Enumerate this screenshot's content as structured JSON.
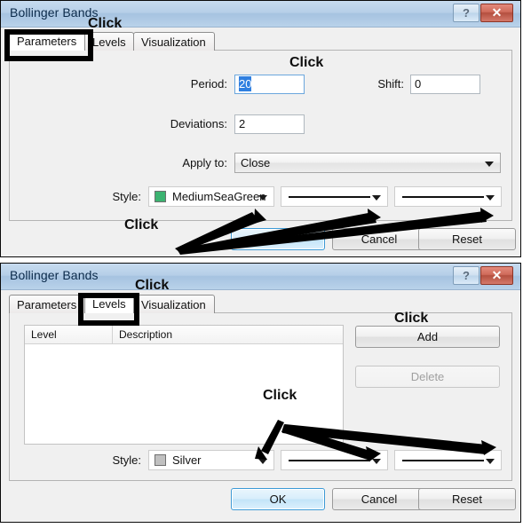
{
  "window_title": "Bollinger Bands",
  "titlebar": {
    "help_label": "?",
    "close_label": "✕"
  },
  "tabs": {
    "parameters": "Parameters",
    "levels": "Levels",
    "visualization": "Visualization"
  },
  "parameters_dialog": {
    "title": "Bollinger Bands",
    "active_tab": "Parameters",
    "fields": {
      "period_label": "Period:",
      "period_value": "20",
      "shift_label": "Shift:",
      "shift_value": "0",
      "deviations_label": "Deviations:",
      "deviations_value": "2",
      "apply_to_label": "Apply to:",
      "apply_to_value": "Close",
      "style_label": "Style:",
      "style_color_name": "MediumSeaGreen",
      "style_color_hex": "#3cb371",
      "line_width_value": "",
      "line_style_value": ""
    },
    "buttons": {
      "ok": "OK",
      "cancel": "Cancel",
      "reset": "Reset"
    }
  },
  "levels_dialog": {
    "title": "Bollinger Bands",
    "active_tab": "Levels",
    "grid": {
      "columns": [
        "Level",
        "Description"
      ],
      "rows": []
    },
    "buttons": {
      "add": "Add",
      "delete": "Delete",
      "ok": "OK",
      "cancel": "Cancel",
      "reset": "Reset"
    },
    "fields": {
      "style_label": "Style:",
      "style_color_name": "Silver",
      "style_color_hex": "#c0c0c0",
      "line_width_value": "",
      "line_style_value": ""
    }
  },
  "annotations": {
    "click_1": "Click",
    "click_2": "Click",
    "click_3": "Click",
    "click_4": "Click",
    "click_5": "Click",
    "click_6": "Click"
  }
}
